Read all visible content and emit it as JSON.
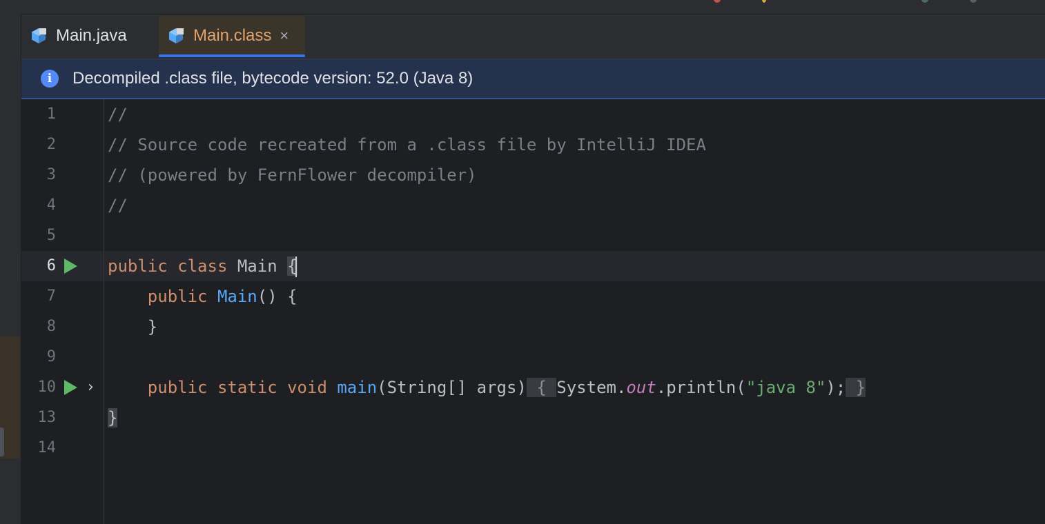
{
  "tabs": [
    {
      "label": "Main.java",
      "active": false,
      "icon": "java-class-icon"
    },
    {
      "label": "Main.class",
      "active": true,
      "icon": "java-class-icon",
      "close": "×"
    }
  ],
  "banner": {
    "icon": "info-icon",
    "text": "Decompiled .class file, bytecode version: 52.0 (Java 8)"
  },
  "editor": {
    "current_line": "6",
    "lines": [
      {
        "num": "1",
        "comment": "//"
      },
      {
        "num": "2",
        "comment": "// Source code recreated from a .class file by IntelliJ IDEA"
      },
      {
        "num": "3",
        "comment": "// (powered by FernFlower decompiler)"
      },
      {
        "num": "4",
        "comment": "//"
      },
      {
        "num": "5"
      },
      {
        "num": "6",
        "kw1": "public",
        "kw2": "class",
        "name": "Main",
        "brace": "{"
      },
      {
        "num": "7",
        "kw": "public",
        "ctor": "Main",
        "rest": "() {"
      },
      {
        "num": "8",
        "brace": "}"
      },
      {
        "num": "9"
      },
      {
        "num": "10",
        "kw1": "public",
        "kw2": "static",
        "kw3": "void",
        "method": "main",
        "params": "(String[] args)",
        "fold_open": "{",
        "call_obj": "System.",
        "field": "out",
        "call_rest": ".println(",
        "string": "\"java 8\"",
        "call_end": ");",
        "fold_close": "}"
      },
      {
        "num": "13",
        "brace": "}"
      },
      {
        "num": "14"
      }
    ]
  },
  "colors": {
    "keyword": "#cf8e6d",
    "function": "#56a8f5",
    "string": "#6aab73",
    "static_field": "#c77dbb",
    "comment": "#7a7e85",
    "banner_bg": "#25324d",
    "accent": "#3574f0",
    "run": "#5fb865"
  }
}
